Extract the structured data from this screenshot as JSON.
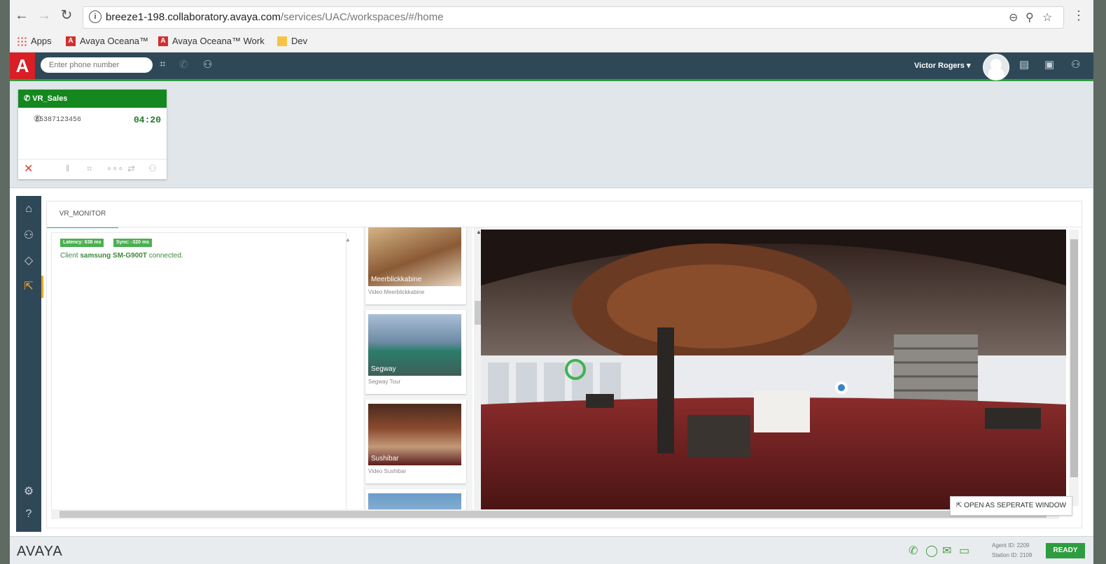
{
  "browser": {
    "url_host": "breeze1-198.collaboratory.avaya.com",
    "url_path": "/services/UAC/workspaces/#/home",
    "bookmarks": [
      "Apps",
      "Avaya Oceana™",
      "Avaya Oceana™ Work",
      "Dev"
    ]
  },
  "header": {
    "logo": "A",
    "phone_placeholder": "Enter phone number",
    "user_name": "Victor Rogers ▾"
  },
  "call": {
    "queue": "VR_Sales",
    "number": "35387123456",
    "timer": "04:20"
  },
  "main": {
    "tab": "VR_MONITOR",
    "latency": "Latency: 638 ms",
    "sync": "Sync: -320 ms",
    "log_prefix": "Client ",
    "log_device": "samsung SM-G900T",
    "log_suffix": " connected.",
    "gallery": [
      {
        "title": "Meerblickkabine",
        "subtitle": "Video Meerblickkabine"
      },
      {
        "title": "Segway",
        "subtitle": "Segway Tour"
      },
      {
        "title": "Sushibar",
        "subtitle": "Video Sushibar"
      },
      {
        "title": "",
        "subtitle": ""
      }
    ],
    "open_window": "OPEN AS SEPERATE WINDOW"
  },
  "footer": {
    "brand": "AVAYA",
    "agent_id": "Agent ID: 2209",
    "station_id": "Station ID: 2109",
    "status": "READY"
  },
  "colors": {
    "brand_red": "#d81f26",
    "nav_dark": "#2f4858",
    "accent_green": "#2e9d3f",
    "active_orange": "#f5a623"
  }
}
